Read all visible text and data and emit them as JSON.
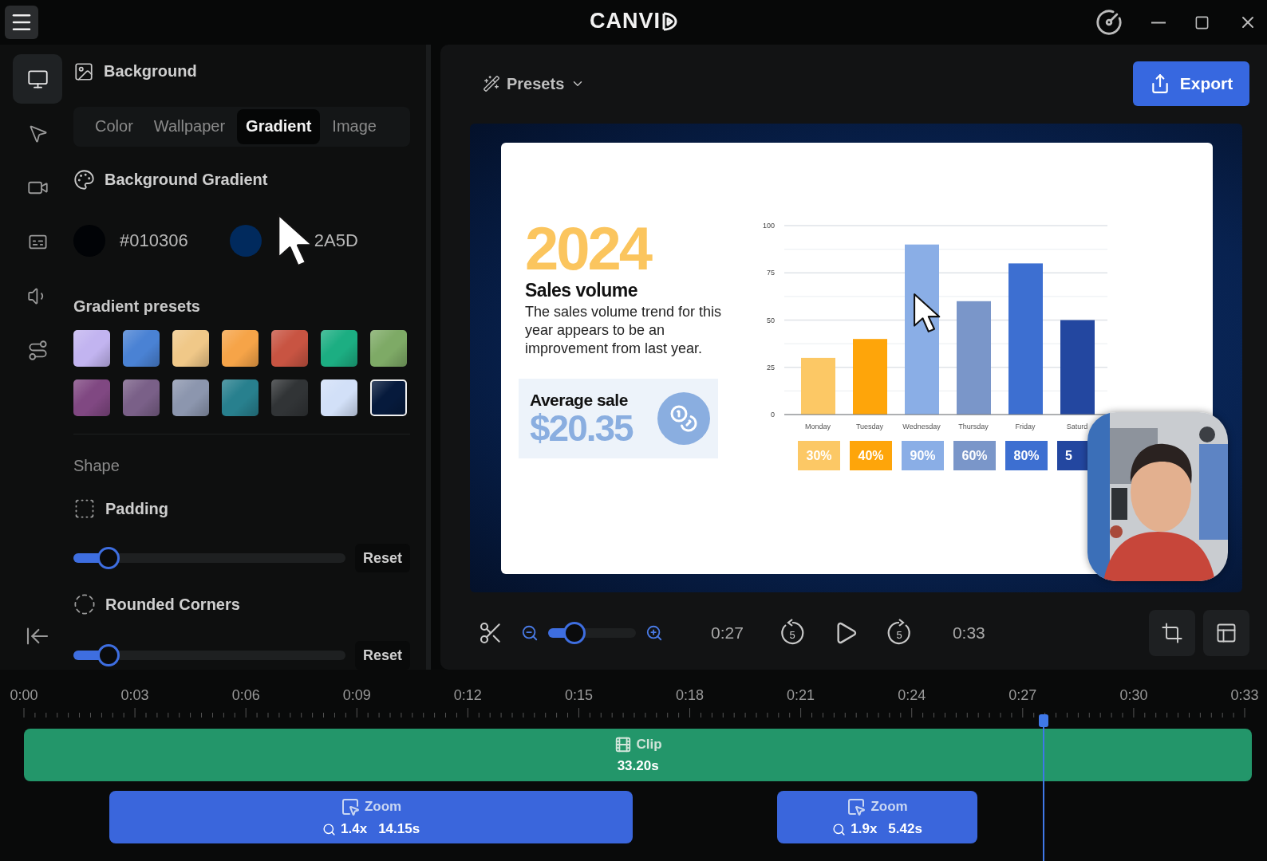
{
  "window": {
    "logo": "CANVI"
  },
  "rail": [
    {
      "kind": "background",
      "selected": true
    },
    {
      "kind": "cursor",
      "selected": false
    },
    {
      "kind": "camera",
      "selected": false
    },
    {
      "kind": "captions",
      "selected": false
    },
    {
      "kind": "audio",
      "selected": false
    },
    {
      "kind": "path",
      "selected": false
    }
  ],
  "panel": {
    "title": "Background",
    "tabs": [
      {
        "label": "Color",
        "selected": false
      },
      {
        "label": "Wallpaper",
        "selected": false
      },
      {
        "label": "Gradient",
        "selected": true
      },
      {
        "label": "Image",
        "selected": false
      }
    ],
    "gradient": {
      "title": "Background Gradient",
      "stops": [
        {
          "color": "#010306",
          "value": "#010306",
          "pointer_over": false
        },
        {
          "color": "#012a5d",
          "value": "2A5D",
          "pointer_over": true
        }
      ]
    },
    "presets": {
      "title": "Gradient presets",
      "items": [
        {
          "color": "#c2b4f0",
          "selected": false
        },
        {
          "color": "#4a82d4",
          "selected": false
        },
        {
          "color": "#f0c888",
          "selected": false
        },
        {
          "color": "#f6a448",
          "selected": false
        },
        {
          "color": "#c85442",
          "selected": false
        },
        {
          "color": "#1cae82",
          "selected": false
        },
        {
          "color": "#7eaa66",
          "selected": false
        },
        {
          "color": "#804882",
          "selected": false
        },
        {
          "color": "#7a6088",
          "selected": false
        },
        {
          "color": "#8c96ae",
          "selected": false
        },
        {
          "color": "#28808e",
          "selected": false
        },
        {
          "color": "#313436",
          "selected": false
        },
        {
          "color": "#d2e0f8",
          "selected": false
        },
        {
          "color": "#061a3c",
          "selected": true
        }
      ]
    },
    "shape": {
      "title": "Shape",
      "controls": [
        {
          "kind": "square",
          "label": "Padding",
          "level": 0.13,
          "reset": "Reset"
        },
        {
          "kind": "circle",
          "label": "Rounded Corners",
          "level": 0.13,
          "reset": "Reset"
        }
      ]
    }
  },
  "toolbar": {
    "presets": "Presets",
    "export": "Export"
  },
  "slide": {
    "year": "2024",
    "heading": "Sales volume",
    "body": "The sales volume trend for this year appears to be an improvement from last year.",
    "average_label": "Average sale",
    "average_value": "$20.35",
    "chart_data": {
      "type": "bar",
      "categories": [
        "Monday",
        "Tuesday",
        "Wednesday",
        "Thursday",
        "Friday",
        "Saturd"
      ],
      "values": [
        30,
        40,
        90,
        60,
        80,
        50
      ],
      "ylim": [
        0,
        100
      ],
      "yticks": [
        0,
        25,
        50,
        75,
        100
      ],
      "grid": true
    },
    "badges": [
      "30%",
      "40%",
      "90%",
      "60%",
      "80%",
      "5"
    ]
  },
  "player": {
    "zoom": {
      "level": 0.3
    },
    "current": "0:27",
    "skip_back": "5",
    "skip_forward": "5",
    "total": "0:33"
  },
  "timeline": {
    "ticks": [
      "0:00",
      "0:03",
      "0:06",
      "0:09",
      "0:12",
      "0:15",
      "0:18",
      "0:21",
      "0:24",
      "0:27",
      "0:30",
      "0:33"
    ],
    "clip": {
      "label": "Clip",
      "duration": "33.20s"
    },
    "zooms": [
      {
        "label": "Zoom",
        "scale": "1.4x",
        "duration": "14.15s"
      },
      {
        "label": "Zoom",
        "scale": "1.9x",
        "duration": "5.42s"
      }
    ]
  }
}
